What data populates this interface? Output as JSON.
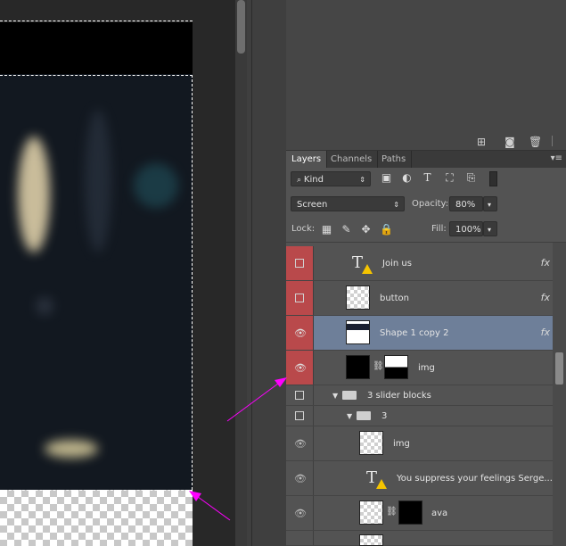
{
  "panel": {
    "tabs": [
      "Layers",
      "Channels",
      "Paths"
    ],
    "menu_icon": "panel-menu-icon",
    "filter_kind": "Kind",
    "blend_mode": "Screen",
    "opacity_label": "Opacity:",
    "opacity_value": "80%",
    "lock_label": "Lock:",
    "fill_label": "Fill:",
    "fill_value": "100%",
    "fx_label": "fx"
  },
  "layers": [
    {
      "name": "Join us",
      "visible": false,
      "selected": false
    },
    {
      "name": "button",
      "visible": false,
      "selected": false
    },
    {
      "name": "Shape 1 copy 2",
      "visible": true,
      "selected": true
    },
    {
      "name": "img",
      "visible": true,
      "selected": false
    },
    {
      "name": "3 slider blocks",
      "visible": false,
      "selected": false
    },
    {
      "name": "3",
      "visible": false,
      "selected": false
    },
    {
      "name": "img",
      "visible": true,
      "selected": false
    },
    {
      "name": "You suppress your feelings Serge...",
      "visible": true,
      "selected": false
    },
    {
      "name": "ava",
      "visible": true,
      "selected": false
    }
  ],
  "colors": {
    "hidden_eye": "#b9494b",
    "selected_row": "#6e7f99",
    "annotation_arrow": "#ff00ff"
  }
}
